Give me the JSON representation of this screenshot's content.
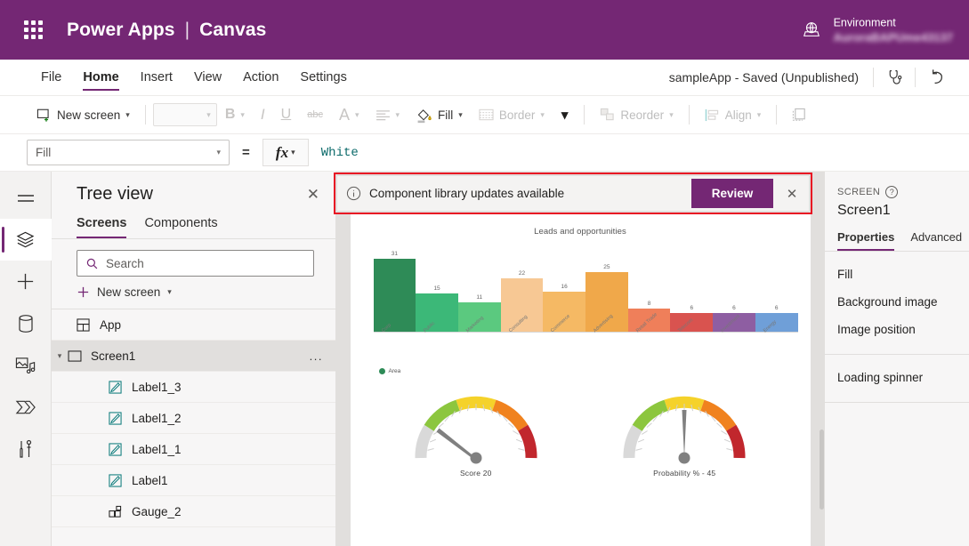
{
  "topbar": {
    "waffle_icon": "app-launcher-icon",
    "brand": "Power Apps",
    "brand_divider": "|",
    "brand_sub": "Canvas",
    "environment_icon": "globe-icon",
    "environment_label": "Environment",
    "environment_name": "AuroraBAPUme43137",
    "bg_color": "#742774"
  },
  "menubar": {
    "items": [
      {
        "label": "File",
        "active": false
      },
      {
        "label": "Home",
        "active": true
      },
      {
        "label": "Insert",
        "active": false
      },
      {
        "label": "View",
        "active": false
      },
      {
        "label": "Action",
        "active": false
      },
      {
        "label": "Settings",
        "active": false
      }
    ],
    "app_status": "sampleApp - Saved (Unpublished)",
    "checker_icon": "app-checker-stethoscope-icon",
    "undo_icon": "undo-arrow-icon"
  },
  "toolbar": {
    "new_screen": "New screen",
    "font_size_value": "",
    "bold": "B",
    "italic": "I",
    "underline": "U",
    "strikethrough": "abc",
    "font_color": "A",
    "align": "align-icon",
    "fill": "Fill",
    "border": "Border",
    "overflow_chevron": "chevron-down-icon",
    "reorder": "Reorder",
    "align_label": "Align",
    "group": "group-icon"
  },
  "formulabar": {
    "property": "Fill",
    "equals": "=",
    "fx": "fx",
    "value": "White"
  },
  "rail": {
    "items": [
      {
        "name": "hamburger-menu-icon",
        "selected": false
      },
      {
        "name": "tree-view-layers-icon",
        "selected": true
      },
      {
        "name": "insert-plus-icon",
        "selected": false
      },
      {
        "name": "data-database-icon",
        "selected": false
      },
      {
        "name": "media-icon",
        "selected": false
      },
      {
        "name": "power-automate-flow-icon",
        "selected": false
      },
      {
        "name": "variables-tools-icon",
        "selected": false
      }
    ]
  },
  "treeview": {
    "title": "Tree view",
    "close_icon": "close-icon",
    "tabs": [
      {
        "label": "Screens",
        "active": true
      },
      {
        "label": "Components",
        "active": false
      }
    ],
    "search_placeholder": "Search",
    "search_value": "",
    "new_screen": "New screen",
    "items": [
      {
        "label": "App",
        "icon": "app-icon",
        "level": 0,
        "selected": false,
        "expandable": false
      },
      {
        "label": "Screen1",
        "icon": "screen-icon",
        "level": 0,
        "selected": true,
        "expandable": true,
        "overflow": "..."
      },
      {
        "label": "Label1_3",
        "icon": "label-icon",
        "level": 1,
        "selected": false,
        "expandable": false
      },
      {
        "label": "Label1_2",
        "icon": "label-icon",
        "level": 1,
        "selected": false,
        "expandable": false
      },
      {
        "label": "Label1_1",
        "icon": "label-icon",
        "level": 1,
        "selected": false,
        "expandable": false
      },
      {
        "label": "Label1",
        "icon": "label-icon",
        "level": 1,
        "selected": false,
        "expandable": false
      },
      {
        "label": "Gauge_2",
        "icon": "gauge-component-icon",
        "level": 1,
        "selected": false,
        "expandable": false
      }
    ]
  },
  "banner": {
    "info_icon": "info-circle-icon",
    "message": "Component library updates available",
    "review_label": "Review",
    "close_icon": "close-icon",
    "highlight_color": "#e81123",
    "button_color": "#742774"
  },
  "properties": {
    "kicker": "SCREEN",
    "help_icon": "help-circle-icon",
    "name": "Screen1",
    "tabs": [
      {
        "label": "Properties",
        "active": true
      },
      {
        "label": "Advanced",
        "active": false
      }
    ],
    "group1": [
      "Fill",
      "Background image",
      "Image position"
    ],
    "group2": [
      "Loading spinner"
    ]
  },
  "chart_data": [
    {
      "type": "bar",
      "title": "Leads and opportunities",
      "categories": [
        "Corp",
        "Public",
        "Marketing",
        "Consulting",
        "Commerce",
        "Advertising",
        "Retail Trade",
        "Telecom",
        "Investment",
        "Energy"
      ],
      "values": [
        31,
        15,
        11,
        22,
        16,
        25,
        8,
        6,
        6,
        6
      ],
      "colors": [
        "#2e8b57",
        "#3cb878",
        "#5bc97f",
        "#f7c894",
        "#f5b964",
        "#f0a84a",
        "#ef7f5a",
        "#d9534f",
        "#8e5ea2",
        "#6f9fd8"
      ],
      "legend": [
        {
          "name": "Area",
          "color": "#2e8b57"
        }
      ],
      "legend_position": "bottom-left",
      "xlabel": "",
      "ylabel": "",
      "ylim": [
        0,
        31
      ],
      "grid": false,
      "data_labels": true
    },
    {
      "type": "gauge",
      "title": "Score",
      "caption": "Score   20",
      "value": 20,
      "min": 0,
      "max": 100,
      "needle_angle_deg": -52,
      "bands": [
        {
          "color": "#d9d9d9",
          "from": 0,
          "to": 10
        },
        {
          "color": "#8cc63e",
          "from": 10,
          "to": 33
        },
        {
          "color": "#f5d22a",
          "from": 33,
          "to": 55
        },
        {
          "color": "#f0821e",
          "from": 55,
          "to": 82
        },
        {
          "color": "#c1272d",
          "from": 82,
          "to": 100
        }
      ]
    },
    {
      "type": "gauge",
      "title": "Probability %",
      "caption": "Probability % -  45",
      "value": 45,
      "min": 0,
      "max": 100,
      "needle_angle_deg": 0,
      "bands": [
        {
          "color": "#d9d9d9",
          "from": 0,
          "to": 10
        },
        {
          "color": "#8cc63e",
          "from": 10,
          "to": 33
        },
        {
          "color": "#f5d22a",
          "from": 33,
          "to": 55
        },
        {
          "color": "#f0821e",
          "from": 55,
          "to": 82
        },
        {
          "color": "#c1272d",
          "from": 82,
          "to": 100
        }
      ]
    }
  ]
}
